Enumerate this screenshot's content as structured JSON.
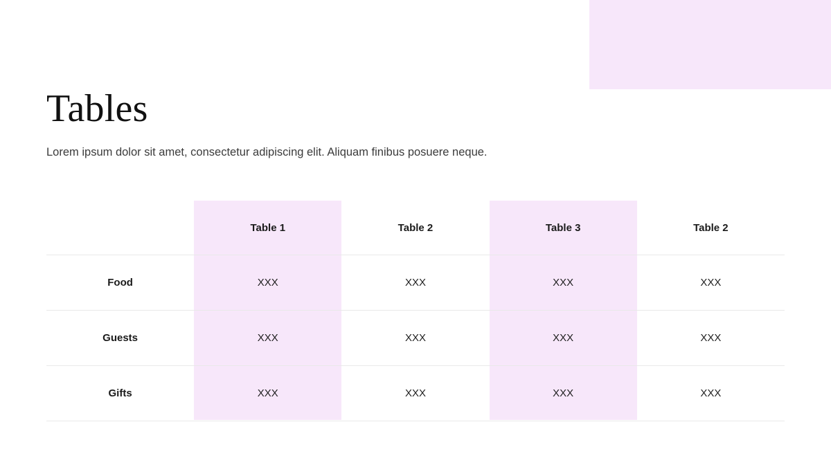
{
  "slide": {
    "title": "Tables",
    "subtitle": "Lorem ipsum dolor sit amet, consectetur adipiscing elit. Aliquam finibus posuere neque."
  },
  "colors": {
    "accent_block": "#f7e7fa",
    "highlight_column": "#f7e7fa",
    "divider": "#e9e9e9",
    "title_text": "#111111",
    "body_text": "#3b3b3b",
    "background": "#ffffff"
  },
  "table": {
    "corner_label": "",
    "columns": [
      {
        "label": "Table 1",
        "highlighted": true
      },
      {
        "label": "Table 2",
        "highlighted": false
      },
      {
        "label": "Table 3",
        "highlighted": true
      },
      {
        "label": "Table 2",
        "highlighted": false
      }
    ],
    "rows": [
      {
        "label": "Food",
        "cells": [
          "XXX",
          "XXX",
          "XXX",
          "XXX"
        ]
      },
      {
        "label": "Guests",
        "cells": [
          "XXX",
          "XXX",
          "XXX",
          "XXX"
        ]
      },
      {
        "label": "Gifts",
        "cells": [
          "XXX",
          "XXX",
          "XXX",
          "XXX"
        ]
      }
    ]
  }
}
